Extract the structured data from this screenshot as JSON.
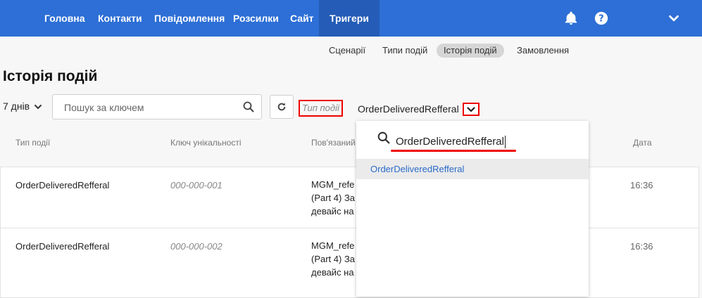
{
  "nav": {
    "items": [
      {
        "label": "Головна"
      },
      {
        "label": "Контакти"
      },
      {
        "label": "Повідомлення"
      },
      {
        "label": "Розсилки"
      },
      {
        "label": "Сайт"
      },
      {
        "label": "Тригери"
      }
    ],
    "active": "Тригери"
  },
  "subnav": {
    "items": [
      {
        "label": "Сценарії"
      },
      {
        "label": "Типи подій"
      },
      {
        "label": "Історія подій"
      },
      {
        "label": "Замовлення"
      }
    ],
    "active": "Історія подій"
  },
  "page": {
    "title": "Історія подій"
  },
  "filters": {
    "period": "7 днів",
    "search_placeholder": "Пошук за ключем",
    "type_label": "Тип події",
    "selected_type": "OrderDeliveredRefferal"
  },
  "table": {
    "headers": [
      "Тип події",
      "Ключ унікальності",
      "Пов'язаний",
      "Дата"
    ],
    "rows": [
      {
        "type": "OrderDeliveredRefferal",
        "key": "000-000-001",
        "linked": [
          "MGM_refer",
          "(Part 4) За",
          "девайс на"
        ],
        "date": "16:36"
      },
      {
        "type": "OrderDeliveredRefferal",
        "key": "000-000-002",
        "linked": [
          "MGM_refer",
          "(Part 4) За",
          "девайс на"
        ],
        "date": "16:36"
      }
    ]
  },
  "dropdown": {
    "search_value": "OrderDeliveredRefferal",
    "options": [
      "OrderDeliveredRefferal"
    ]
  },
  "colors": {
    "nav_bg": "#2d6fd6",
    "nav_active_bg": "#245cb7",
    "highlight": "#e00000",
    "option_text": "#2a6bc9"
  },
  "icons": [
    "bell-icon",
    "help-icon",
    "chevron-down-icon",
    "search-icon",
    "refresh-icon"
  ]
}
